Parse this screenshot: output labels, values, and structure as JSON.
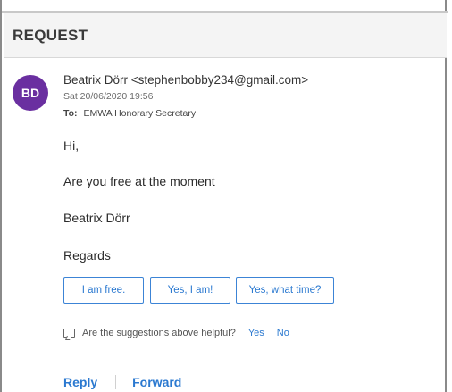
{
  "email": {
    "subject": "REQUEST",
    "avatar_initials": "BD",
    "avatar_color": "#6a2fa0",
    "sender": "Beatrix Dörr <stephenbobby234@gmail.com>",
    "date": "Sat 20/06/2020 19:56",
    "to_label": "To:",
    "to_value": "EMWA Honorary Secretary",
    "body": {
      "greeting": "Hi,",
      "line1": "Are you free at the moment",
      "line2": "Beatrix Dörr",
      "line3": "Regards"
    }
  },
  "suggestions": [
    {
      "label": "I am free."
    },
    {
      "label": "Yes, I am!"
    },
    {
      "label": "Yes, what time?"
    }
  ],
  "feedback": {
    "icon": "feedback-icon",
    "question": "Are the suggestions above helpful?",
    "yes": "Yes",
    "no": "No"
  },
  "actions": {
    "reply": "Reply",
    "forward": "Forward"
  },
  "colors": {
    "accent": "#2b79d0",
    "header_bg": "#f4f4f4"
  }
}
